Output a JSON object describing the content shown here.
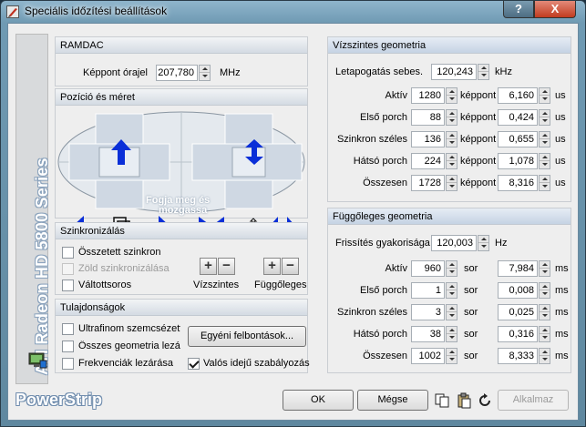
{
  "window": {
    "title": "Speciális időzítési beállítások",
    "help": "?",
    "close": "X"
  },
  "sidebar": {
    "vertical_text": "ATI Radeon HD 5800 Series",
    "brand": "PowerStrip"
  },
  "ramdac": {
    "header": "RAMDAC",
    "label": "Képpont órajel",
    "value": "207,780",
    "unit": "MHz"
  },
  "position": {
    "header": "Pozíció és méret",
    "drag_text_1": "Fogja meg és",
    "drag_text_2": "mozgassa"
  },
  "sync": {
    "header": "Szinkronizálás",
    "composite": "Összetett szinkron",
    "sync_on_green": "Zöld szinkronizálása",
    "alternating": "Váltottsoros",
    "horizontal": "Vízszintes",
    "vertical": "Függőleges",
    "plus": "+",
    "minus": "−"
  },
  "props": {
    "header": "Tulajdonságok",
    "ultrafine": "Ultrafinom szemcsézett...",
    "lock_geometry": "Összes geometria lezárása",
    "lock_freq": "Frekvenciák lezárása",
    "custom_res": "Egyéni felbontások...",
    "realtime": "Valós idejű szabályozás"
  },
  "hgeo": {
    "header": "Vízszintes geometria",
    "scan_label": "Letapogatás sebes.",
    "scan_value": "120,243",
    "scan_unit": "kHz",
    "unit_mid": "képpont",
    "unit_right": "us",
    "rows": [
      {
        "label": "Aktív",
        "value": "1280",
        "time": "6,160"
      },
      {
        "label": "Első porch",
        "value": "88",
        "time": "0,424"
      },
      {
        "label": "Szinkron széles",
        "value": "136",
        "time": "0,655"
      },
      {
        "label": "Hátsó porch",
        "value": "224",
        "time": "1,078"
      },
      {
        "label": "Összesen",
        "value": "1728",
        "time": "8,316"
      }
    ]
  },
  "vgeo": {
    "header": "Függőleges geometria",
    "refresh_label": "Frissítés gyakorisága",
    "refresh_value": "120,003",
    "refresh_unit": "Hz",
    "unit_mid": "sor",
    "unit_right": "ms",
    "rows": [
      {
        "label": "Aktív",
        "value": "960",
        "time": "7,984"
      },
      {
        "label": "Első porch",
        "value": "1",
        "time": "0,008"
      },
      {
        "label": "Szinkron széles",
        "value": "3",
        "time": "0,025"
      },
      {
        "label": "Hátsó porch",
        "value": "38",
        "time": "0,316"
      },
      {
        "label": "Összesen",
        "value": "1002",
        "time": "8,333"
      }
    ]
  },
  "footer": {
    "ok": "OK",
    "cancel": "Mégse",
    "apply": "Alkalmaz"
  },
  "colors": {
    "arrow": "#0a2fd8",
    "title_bg": "#7fa6be"
  }
}
